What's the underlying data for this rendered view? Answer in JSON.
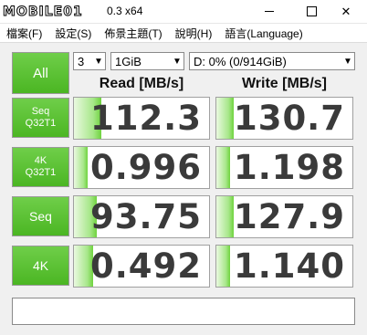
{
  "window": {
    "logo_text": "MOBILE01",
    "title": "0.3 x64"
  },
  "menu": {
    "items": [
      "檔案(F)",
      "設定(S)",
      "佈景主題(T)",
      "說明(H)",
      "語言(Language)"
    ]
  },
  "controls": {
    "all_label": "All",
    "test_count": "3",
    "test_size": "1GiB",
    "drive": "D: 0% (0/914GiB)"
  },
  "headers": {
    "read": "Read [MB/s]",
    "write": "Write [MB/s]"
  },
  "tests": [
    {
      "label_line1": "Seq",
      "label_line2": "Q32T1",
      "read": "112.3",
      "write": "130.7",
      "read_fill": 0.2,
      "write_fill": 0.13
    },
    {
      "label_line1": "4K",
      "label_line2": "Q32T1",
      "read": "0.996",
      "write": "1.198",
      "read_fill": 0.1,
      "write_fill": 0.1
    },
    {
      "label_line1": "Seq",
      "label_line2": "",
      "read": "93.75",
      "write": "127.9",
      "read_fill": 0.17,
      "write_fill": 0.13
    },
    {
      "label_line1": "4K",
      "label_line2": "",
      "read": "0.492",
      "write": "1.140",
      "read_fill": 0.14,
      "write_fill": 0.1
    }
  ],
  "comment": ""
}
